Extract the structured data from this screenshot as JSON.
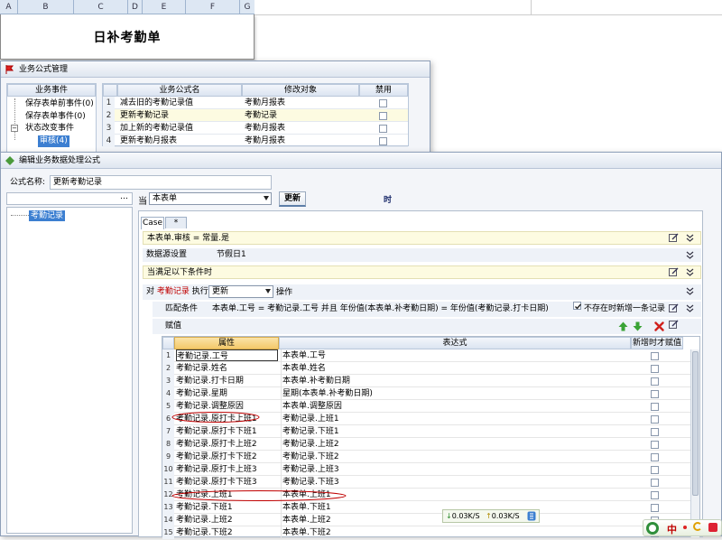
{
  "spreadsheet": {
    "columns": [
      "A",
      "B",
      "C",
      "D",
      "E",
      "F",
      "G"
    ],
    "title": "日补考勤单"
  },
  "formula_manager": {
    "title": "业务公式管理",
    "event_header": "业务事件",
    "events": [
      "保存表单前事件(0)",
      "保存表单事件(0)",
      "状态改变事件",
      "审核(4)"
    ],
    "headers": {
      "name": "业务公式名",
      "target": "修改对象",
      "disabled": "禁用"
    },
    "rows": [
      {
        "num": "1",
        "name": "减去旧的考勤记录值",
        "target": "考勤月报表"
      },
      {
        "num": "2",
        "name": "更新考勤记录",
        "target": "考勤记录"
      },
      {
        "num": "3",
        "name": "加上新的考勤记录值",
        "target": "考勤月报表"
      },
      {
        "num": "4",
        "name": "更新考勤月报表",
        "target": "考勤月报表"
      }
    ]
  },
  "editor": {
    "title": "编辑业务数据处理公式",
    "name_label": "公式名称:",
    "name_value": "更新考勤记录",
    "tree_item": "考勤记录",
    "when_label": "当",
    "when_select": "本表单",
    "when_button": "更新",
    "when_suffix": "时",
    "tabs": [
      "Case",
      "*"
    ],
    "condition": "本表单.审核 = 常量.是",
    "datasource_label": "数据源设置",
    "datasource_value": "节假日1",
    "satisfy_label": "当满足以下条件时",
    "exec_prefix": "对",
    "exec_target": "考勤记录",
    "exec_mid": "执行",
    "exec_select": "更新",
    "exec_suffix": "操作",
    "match_label": "匹配条件",
    "match_value": "本表单.工号 = 考勤记录.工号 并且 年份值(本表单.补考勤日期) = 年份值(考勤记录.打卡日期)",
    "no_exist_label": "不存在时新增一条记录",
    "assign_label": "赋值",
    "grid_headers": {
      "attr": "属性",
      "expr": "表达式",
      "new": "新增时才赋值"
    },
    "rows": [
      {
        "num": "1",
        "attr": "考勤记录.工号",
        "expr": "本表单.工号"
      },
      {
        "num": "2",
        "attr": "考勤记录.姓名",
        "expr": "本表单.姓名"
      },
      {
        "num": "3",
        "attr": "考勤记录.打卡日期",
        "expr": "本表单.补考勤日期"
      },
      {
        "num": "4",
        "attr": "考勤记录.星期",
        "expr": "星期(本表单.补考勤日期)"
      },
      {
        "num": "5",
        "attr": "考勤记录.调整原因",
        "expr": "本表单.调整原因"
      },
      {
        "num": "6",
        "attr": "考勤记录.原打卡上班1",
        "expr": "考勤记录.上班1"
      },
      {
        "num": "7",
        "attr": "考勤记录.原打卡下班1",
        "expr": "考勤记录.下班1"
      },
      {
        "num": "8",
        "attr": "考勤记录.原打卡上班2",
        "expr": "考勤记录.上班2"
      },
      {
        "num": "9",
        "attr": "考勤记录.原打卡下班2",
        "expr": "考勤记录.下班2"
      },
      {
        "num": "10",
        "attr": "考勤记录.原打卡上班3",
        "expr": "考勤记录.上班3"
      },
      {
        "num": "11",
        "attr": "考勤记录.原打卡下班3",
        "expr": "考勤记录.下班3"
      },
      {
        "num": "12",
        "attr": "考勤记录.上班1",
        "expr": "本表单.上班1"
      },
      {
        "num": "13",
        "attr": "考勤记录.下班1",
        "expr": "本表单.下班1"
      },
      {
        "num": "14",
        "attr": "考勤记录.上班2",
        "expr": "本表单.上班2"
      },
      {
        "num": "15",
        "attr": "考勤记录.下班2",
        "expr": "本表单.下班2"
      }
    ]
  },
  "net_widget": {
    "down": "0.03K/S",
    "up": "0.03K/S"
  },
  "ime": {
    "label": "中"
  },
  "colors": {
    "accent_red": "#c00000",
    "selection": "#3c7fd1",
    "highlight_row": "#fdfbe1"
  }
}
